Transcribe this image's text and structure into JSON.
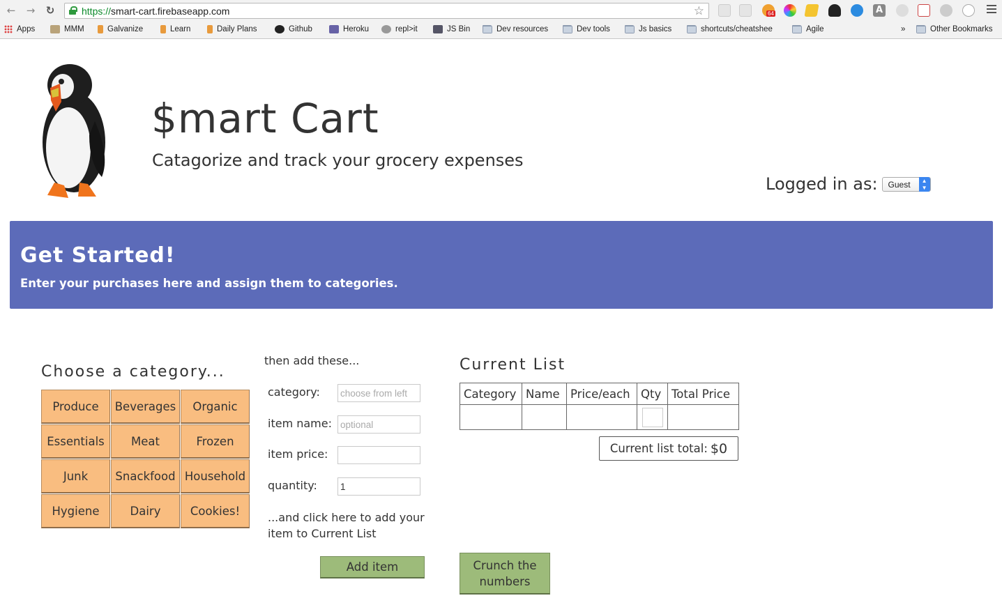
{
  "browser": {
    "url_scheme": "https://",
    "url_rest": "smart-cart.firebaseapp.com",
    "bookmarks": [
      {
        "label": "Apps",
        "icon": "apps-grid-icon"
      },
      {
        "label": "MMM",
        "icon": "map-icon"
      },
      {
        "label": "Galvanize",
        "icon": "galvanize-icon"
      },
      {
        "label": "Learn",
        "icon": "galvanize-icon"
      },
      {
        "label": "Daily Plans",
        "icon": "galvanize-icon"
      },
      {
        "label": "Github",
        "icon": "github-icon"
      },
      {
        "label": "Heroku",
        "icon": "heroku-icon"
      },
      {
        "label": "repl>it",
        "icon": "repl-icon"
      },
      {
        "label": "JS Bin",
        "icon": "jsbin-icon"
      },
      {
        "label": "Dev resources",
        "icon": "folder-icon"
      },
      {
        "label": "Dev tools",
        "icon": "folder-icon"
      },
      {
        "label": "Js basics",
        "icon": "folder-icon"
      },
      {
        "label": "shortcuts/cheatshee",
        "icon": "folder-icon"
      },
      {
        "label": "Agile",
        "icon": "folder-icon"
      }
    ],
    "overflow": "»",
    "other_bookmarks": "Other Bookmarks",
    "extension_badge": "64"
  },
  "header": {
    "title": "$mart Cart",
    "subtitle": "Catagorize and track your grocery expenses",
    "logged_in_label": "Logged in as:",
    "user": "Guest"
  },
  "banner": {
    "title": "Get Started!",
    "text": "Enter your purchases here and assign them to categories."
  },
  "categories": {
    "heading": "Choose a category...",
    "items": [
      "Produce",
      "Beverages",
      "Organic",
      "Essentials",
      "Meat",
      "Frozen",
      "Junk",
      "Snackfood",
      "Household",
      "Hygiene",
      "Dairy",
      "Cookies!"
    ]
  },
  "form": {
    "heading": "then add these...",
    "category_label": "category:",
    "category_placeholder": "choose from left",
    "name_label": "item name:",
    "name_placeholder": "optional",
    "price_label": "item price:",
    "qty_label": "quantity:",
    "qty_value": "1",
    "note": "...and click here to add your item to Current List",
    "add_button": "Add item"
  },
  "current_list": {
    "heading": "Current List",
    "columns": [
      "Category",
      "Name",
      "Price/each",
      "Qty",
      "Total Price"
    ],
    "total_label": "Current list total: ",
    "total_value": "$0",
    "crunch_button": "Crunch the numbers"
  },
  "colors": {
    "banner": "#5c6bb9",
    "category_button": "#f9bd80",
    "action_button": "#9dbb7a"
  }
}
